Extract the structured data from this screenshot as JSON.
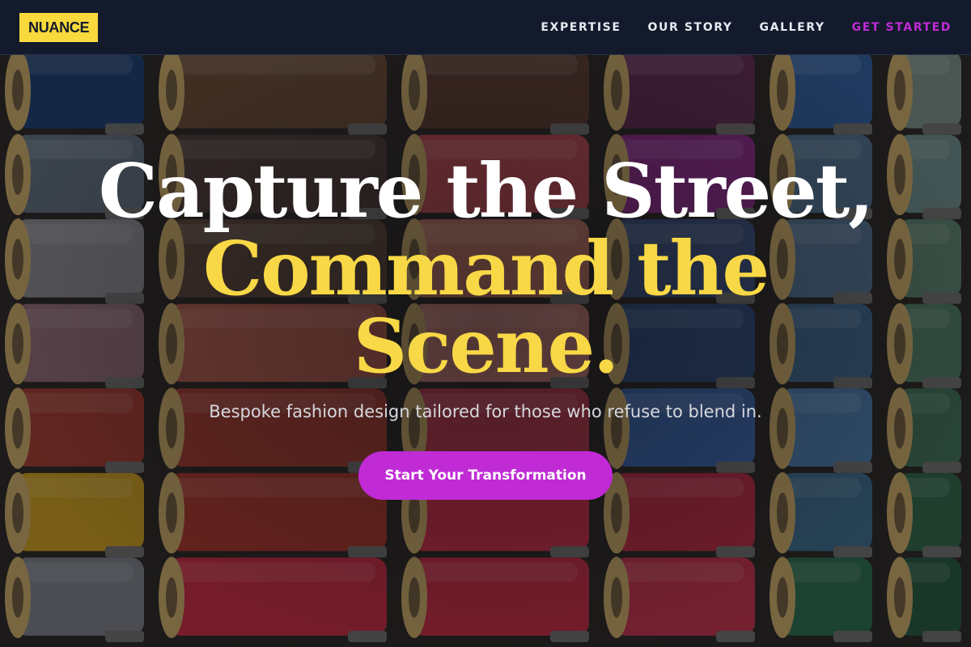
{
  "brand": {
    "logo_text": "NUANCE"
  },
  "nav": {
    "items": [
      {
        "label": "EXPERTISE"
      },
      {
        "label": "OUR STORY"
      },
      {
        "label": "GALLERY"
      },
      {
        "label": "GET STARTED"
      }
    ]
  },
  "hero": {
    "headline_line1": "Capture the Street,",
    "headline_line2": "Command the",
    "headline_line3": "Scene.",
    "subtitle": "Bespoke fashion design tailored for those who refuse to blend in.",
    "cta_label": "Start Your Transformation",
    "background_image": "thread-spools-photo"
  },
  "colors": {
    "accent_yellow": "#f8da3c",
    "accent_magenta": "#c02bd6",
    "nav_background": "#131a2c"
  }
}
